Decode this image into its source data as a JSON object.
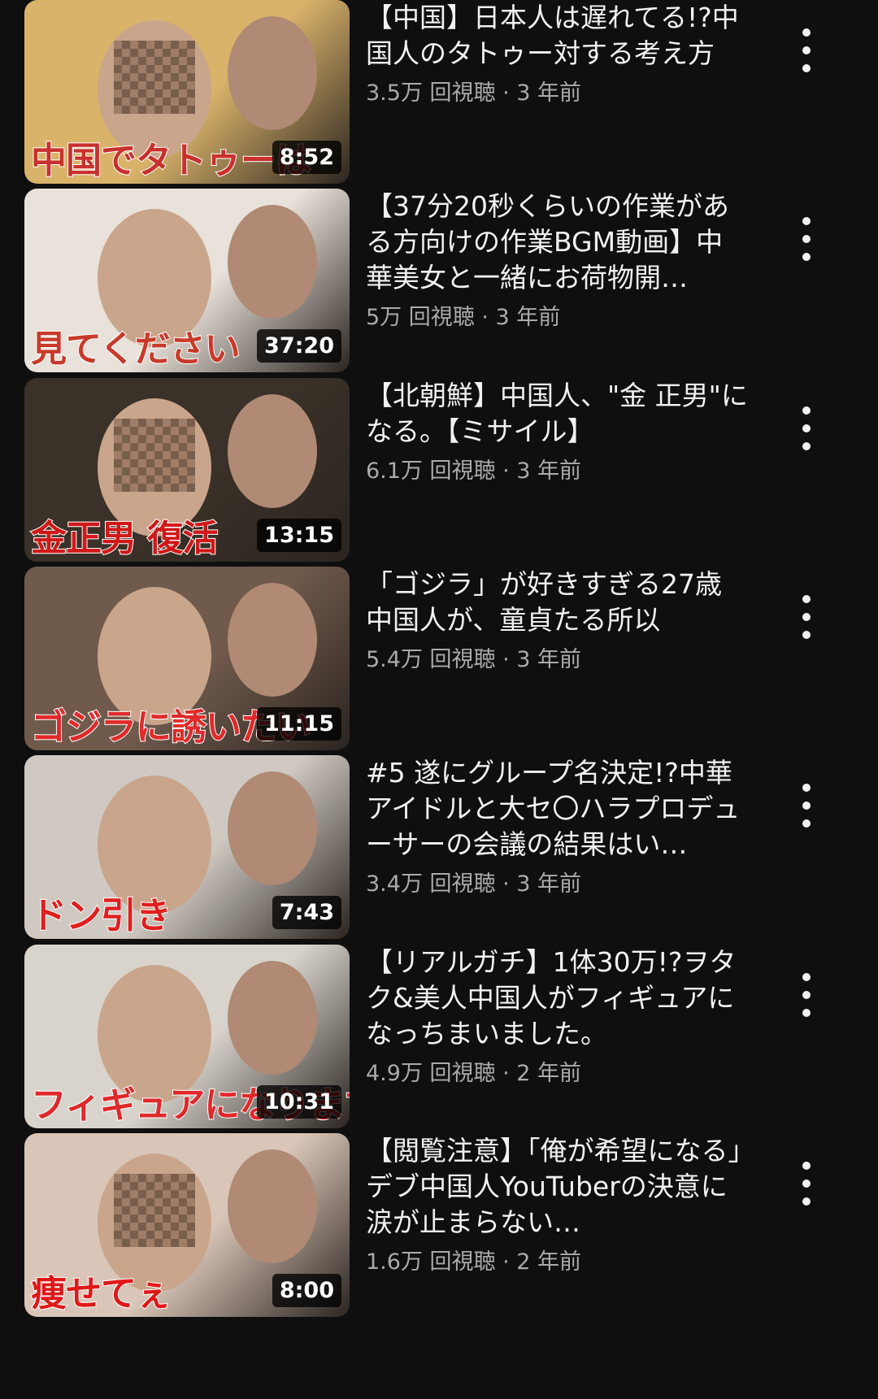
{
  "videos": [
    {
      "title": "【中国】日本人は遅れてる!?中国人のタトゥー対する考え方",
      "views": "3.5万 回視聴",
      "age": "3 年前",
      "duration": "8:52",
      "thumb_text": "中国でタトゥーは",
      "thumb_colors": [
        "#d9b36a",
        "#c9302c"
      ]
    },
    {
      "title": "【37分20秒くらいの作業がある方向けの作業BGM動画】中華美女と一緒にお荷物開…",
      "views": "5万 回視聴",
      "age": "3 年前",
      "duration": "37:20",
      "thumb_text": "見てください",
      "thumb_colors": [
        "#e8e2da",
        "#c83a2a"
      ]
    },
    {
      "title": "【北朝鮮】中国人、\"金 正男\"になる。【ミサイル】",
      "views": "6.1万 回視聴",
      "age": "3 年前",
      "duration": "13:15",
      "thumb_text": "金正男 復活",
      "thumb_colors": [
        "#3a3128",
        "#d01818"
      ]
    },
    {
      "title": "「ゴジラ」が好きすぎる27歳中国人が、童貞たる所以",
      "views": "5.4万 回視聴",
      "age": "3 年前",
      "duration": "11:15",
      "thumb_text": "ゴジラに誘いたい",
      "thumb_colors": [
        "#6f5a4c",
        "#e02a2a"
      ]
    },
    {
      "title": "#5 遂にグループ名決定!?中華アイドルと大セ〇ハラプロデューサーの会議の結果はい…",
      "views": "3.4万 回視聴",
      "age": "3 年前",
      "duration": "7:43",
      "thumb_text": "ドン引き",
      "thumb_colors": [
        "#cfc9c2",
        "#e01f1f"
      ]
    },
    {
      "title": "【リアルガチ】1体30万!?ヲタク&美人中国人がフィギュアになっちまいました。",
      "views": "4.9万 回視聴",
      "age": "2 年前",
      "duration": "10:31",
      "thumb_text": "フィギュアになります",
      "thumb_colors": [
        "#d8d4cc",
        "#e0282a"
      ]
    },
    {
      "title": "【閲覧注意】「俺が希望になる」デブ中国人YouTuberの決意に涙が止まらない…",
      "views": "1.6万 回視聴",
      "age": "2 年前",
      "duration": "8:00",
      "thumb_text": "痩せてぇ",
      "thumb_colors": [
        "#d9c6b8",
        "#e01818"
      ]
    }
  ]
}
